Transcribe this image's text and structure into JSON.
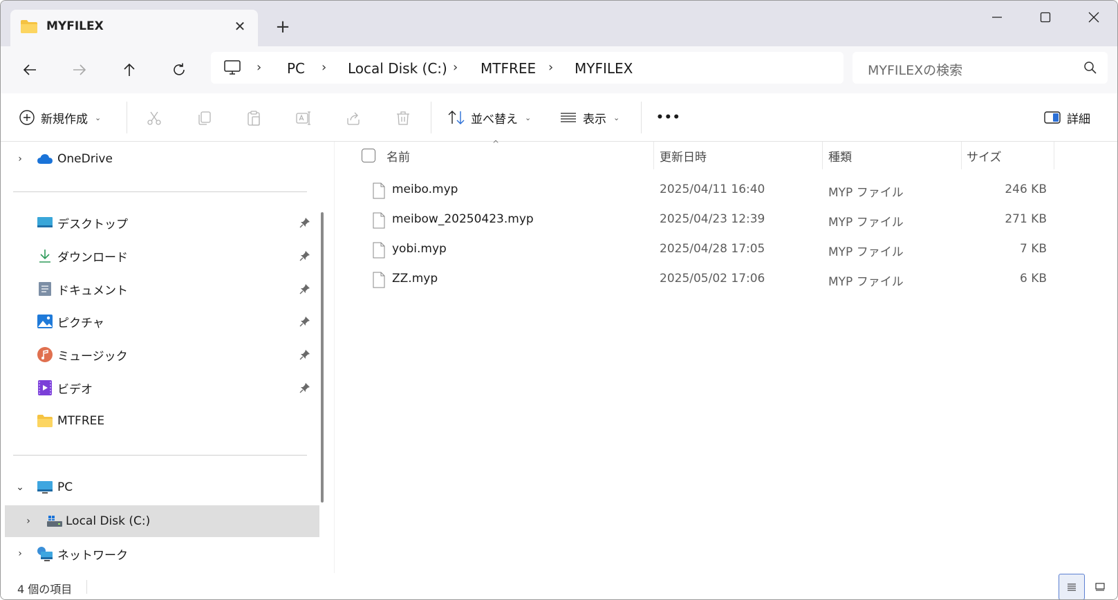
{
  "tab": {
    "title": "MYFILEX",
    "close_glyph": "✕",
    "new_tab_glyph": "+"
  },
  "window_controls": {
    "minimize": "—",
    "maximize": "☐",
    "close": "✕"
  },
  "navigation": {
    "back_icon": "arrow-left-icon",
    "forward_icon": "arrow-right-icon",
    "up_icon": "arrow-up-icon",
    "refresh_icon": "refresh-icon"
  },
  "address": {
    "crumbs": [
      "PC",
      "Local Disk (C:)",
      "MTFREE",
      "MYFILEX"
    ],
    "separator": "›"
  },
  "search": {
    "placeholder": "MYFILEXの検索"
  },
  "commands": {
    "new_label": "新規作成",
    "sort_label": "並べ替え",
    "view_label": "表示",
    "more_label": "•••",
    "details_label": "詳細"
  },
  "sidebar": {
    "onedrive": "OneDrive",
    "quick": [
      {
        "label": "デスクトップ"
      },
      {
        "label": "ダウンロード"
      },
      {
        "label": "ドキュメント"
      },
      {
        "label": "ピクチャ"
      },
      {
        "label": "ミュージック"
      },
      {
        "label": "ビデオ"
      },
      {
        "label": "MTFREE"
      }
    ],
    "pc": "PC",
    "local_disk": "Local Disk (C:)",
    "network": "ネットワーク"
  },
  "columns": {
    "name": "名前",
    "date": "更新日時",
    "type": "種類",
    "size": "サイズ"
  },
  "files": [
    {
      "name": "meibo.myp",
      "date": "2025/04/11 16:40",
      "type": "MYP ファイル",
      "size": "246 KB"
    },
    {
      "name": "meibow_20250423.myp",
      "date": "2025/04/23 12:39",
      "type": "MYP ファイル",
      "size": "271 KB"
    },
    {
      "name": "yobi.myp",
      "date": "2025/04/28 17:05",
      "type": "MYP ファイル",
      "size": "7 KB"
    },
    {
      "name": "ZZ.myp",
      "date": "2025/05/02 17:06",
      "type": "MYP ファイル",
      "size": "6 KB"
    }
  ],
  "status": {
    "item_count": "4 個の項目"
  },
  "colors": {
    "folder": "#f5c342",
    "accent": "#2b6fd6",
    "selected_bg": "#dedede"
  }
}
